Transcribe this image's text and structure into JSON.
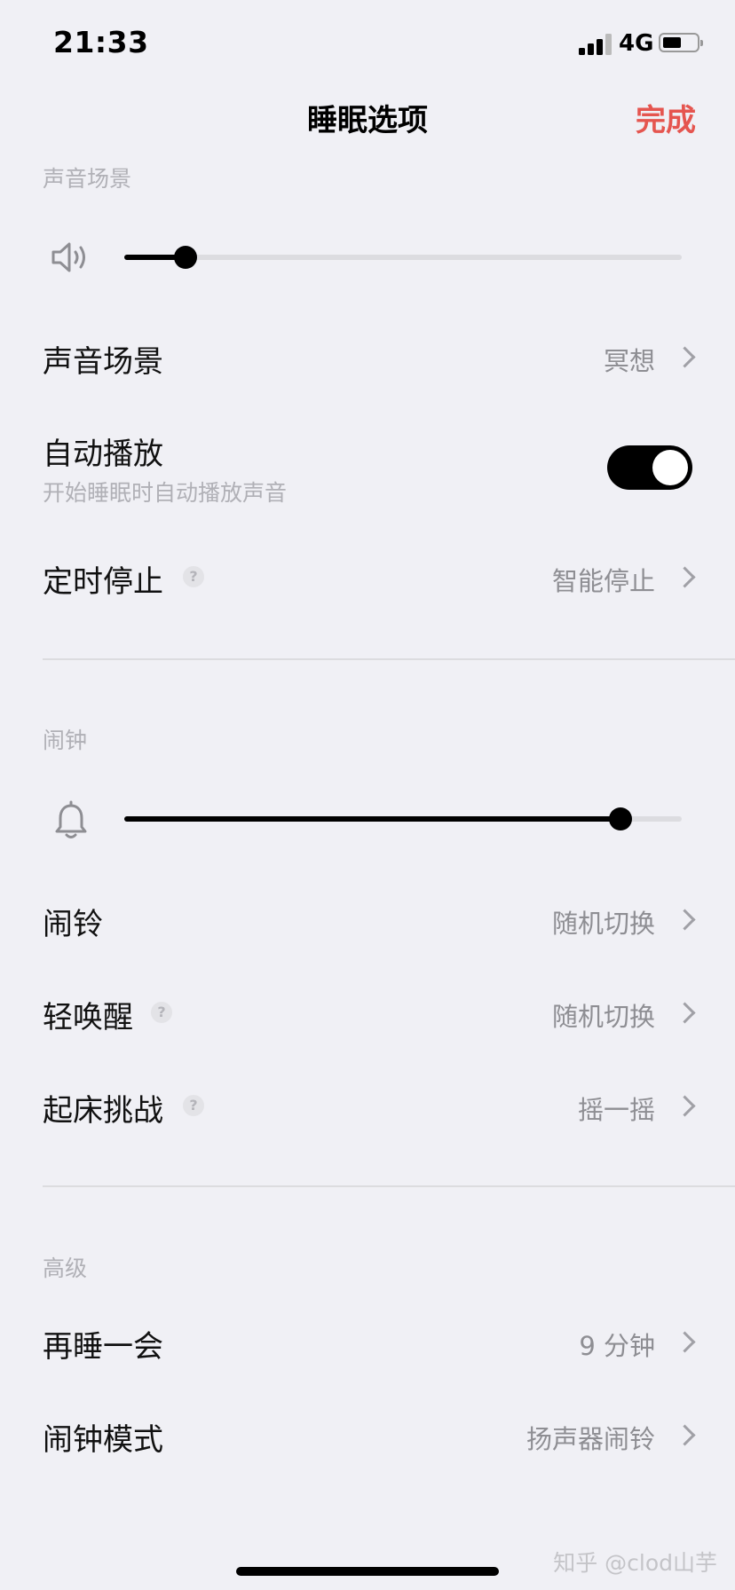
{
  "status_bar": {
    "time": "21:33",
    "network": "4G"
  },
  "nav": {
    "title": "睡眠选项",
    "done_label": "完成"
  },
  "sound_section": {
    "header": "声音场景",
    "volume_level": 0.11,
    "rows": [
      {
        "label": "声音场景",
        "value": "冥想"
      },
      {
        "label": "自动播放",
        "subtitle": "开始睡眠时自动播放声音",
        "toggle_on": true
      },
      {
        "label": "定时停止",
        "help": "?",
        "value": "智能停止"
      }
    ]
  },
  "alarm_section": {
    "header": "闹钟",
    "volume_level": 0.89,
    "rows": [
      {
        "label": "闹铃",
        "value": "随机切换"
      },
      {
        "label": "轻唤醒",
        "help": "?",
        "value": "随机切换"
      },
      {
        "label": "起床挑战",
        "help": "?",
        "value": "摇一摇"
      }
    ]
  },
  "advanced_section": {
    "header": "高级",
    "rows": [
      {
        "label": "再睡一会",
        "value": "9 分钟"
      },
      {
        "label": "闹钟模式",
        "value": "扬声器闹铃"
      }
    ]
  },
  "watermark": "知乎 @clod山芋",
  "colors": {
    "accent": "#e5554f",
    "background": "#f0f0f5",
    "secondary_text": "#8e8e93"
  }
}
